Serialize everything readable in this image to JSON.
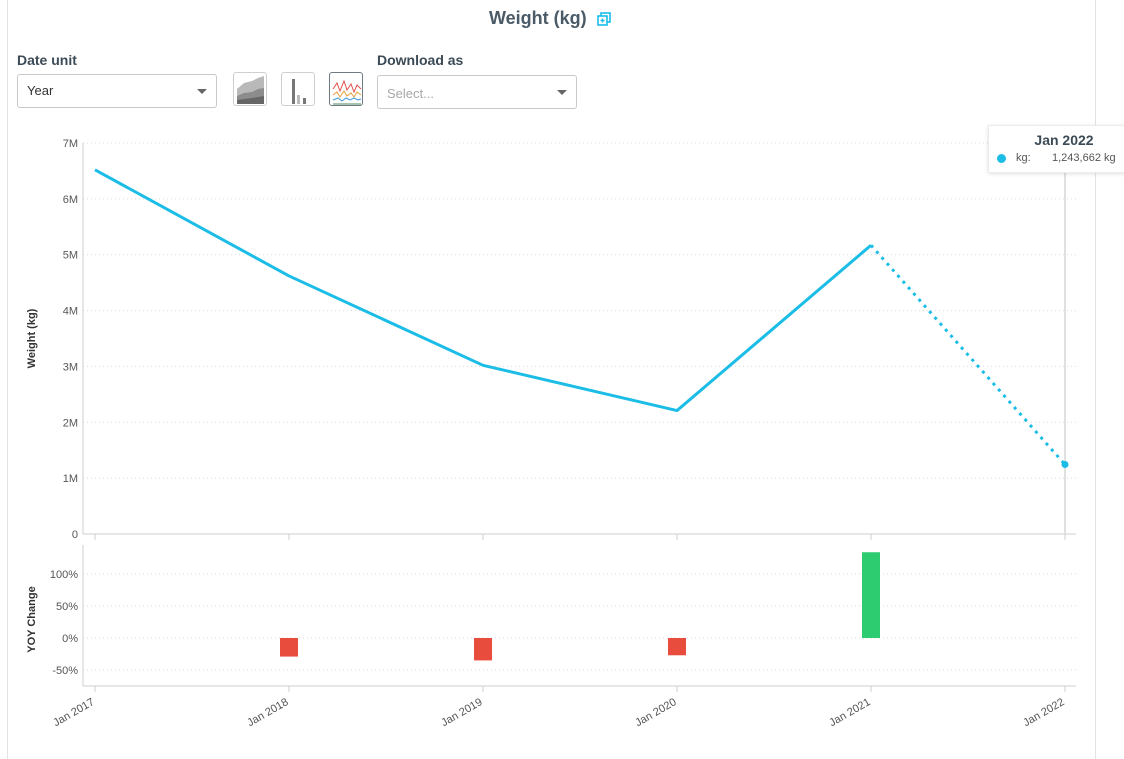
{
  "header": {
    "title": "Weight (kg)"
  },
  "controls": {
    "date_unit_label": "Date unit",
    "date_unit_value": "Year",
    "download_label": "Download as",
    "download_placeholder": "Select..."
  },
  "chart_types": [
    {
      "name": "area-chart-icon",
      "active": false
    },
    {
      "name": "bar-chart-icon",
      "active": false
    },
    {
      "name": "line-chart-icon",
      "active": true
    }
  ],
  "tooltip": {
    "title": "Jan 2022",
    "label": "kg:",
    "value": "1,243,662 kg",
    "color": "#1bbde7"
  },
  "colors": {
    "line": "#1bbde7",
    "positive": "#2ecc71",
    "negative": "#e74c3c",
    "accent": "#1bbde7"
  },
  "chart_data": [
    {
      "type": "line",
      "x": [
        "Jan 2017",
        "Jan 2018",
        "Jan 2019",
        "Jan 2020",
        "Jan 2021",
        "Jan 2022"
      ],
      "series": [
        {
          "values": [
            6520000,
            4620000,
            3020000,
            2210000,
            5170000,
            1243662
          ]
        }
      ],
      "projected_from_index": 4,
      "ylabel": "Weight (kg)",
      "ylim": [
        0,
        7000000
      ],
      "yticks": [
        "0",
        "1M",
        "2M",
        "3M",
        "4M",
        "5M",
        "6M",
        "7M"
      ],
      "grid": true
    },
    {
      "type": "bar",
      "categories": [
        "Jan 2018",
        "Jan 2019",
        "Jan 2020",
        "Jan 2021"
      ],
      "values": [
        -29,
        -35,
        -27,
        134
      ],
      "ylabel": "YOY Change",
      "yticks": [
        "100%",
        "50%",
        "0%",
        "-50%"
      ],
      "ylim": [
        -60,
        140
      ],
      "grid": true
    }
  ],
  "xticks": [
    "Jan 2017",
    "Jan 2018",
    "Jan 2019",
    "Jan 2020",
    "Jan 2021",
    "Jan 2022"
  ]
}
